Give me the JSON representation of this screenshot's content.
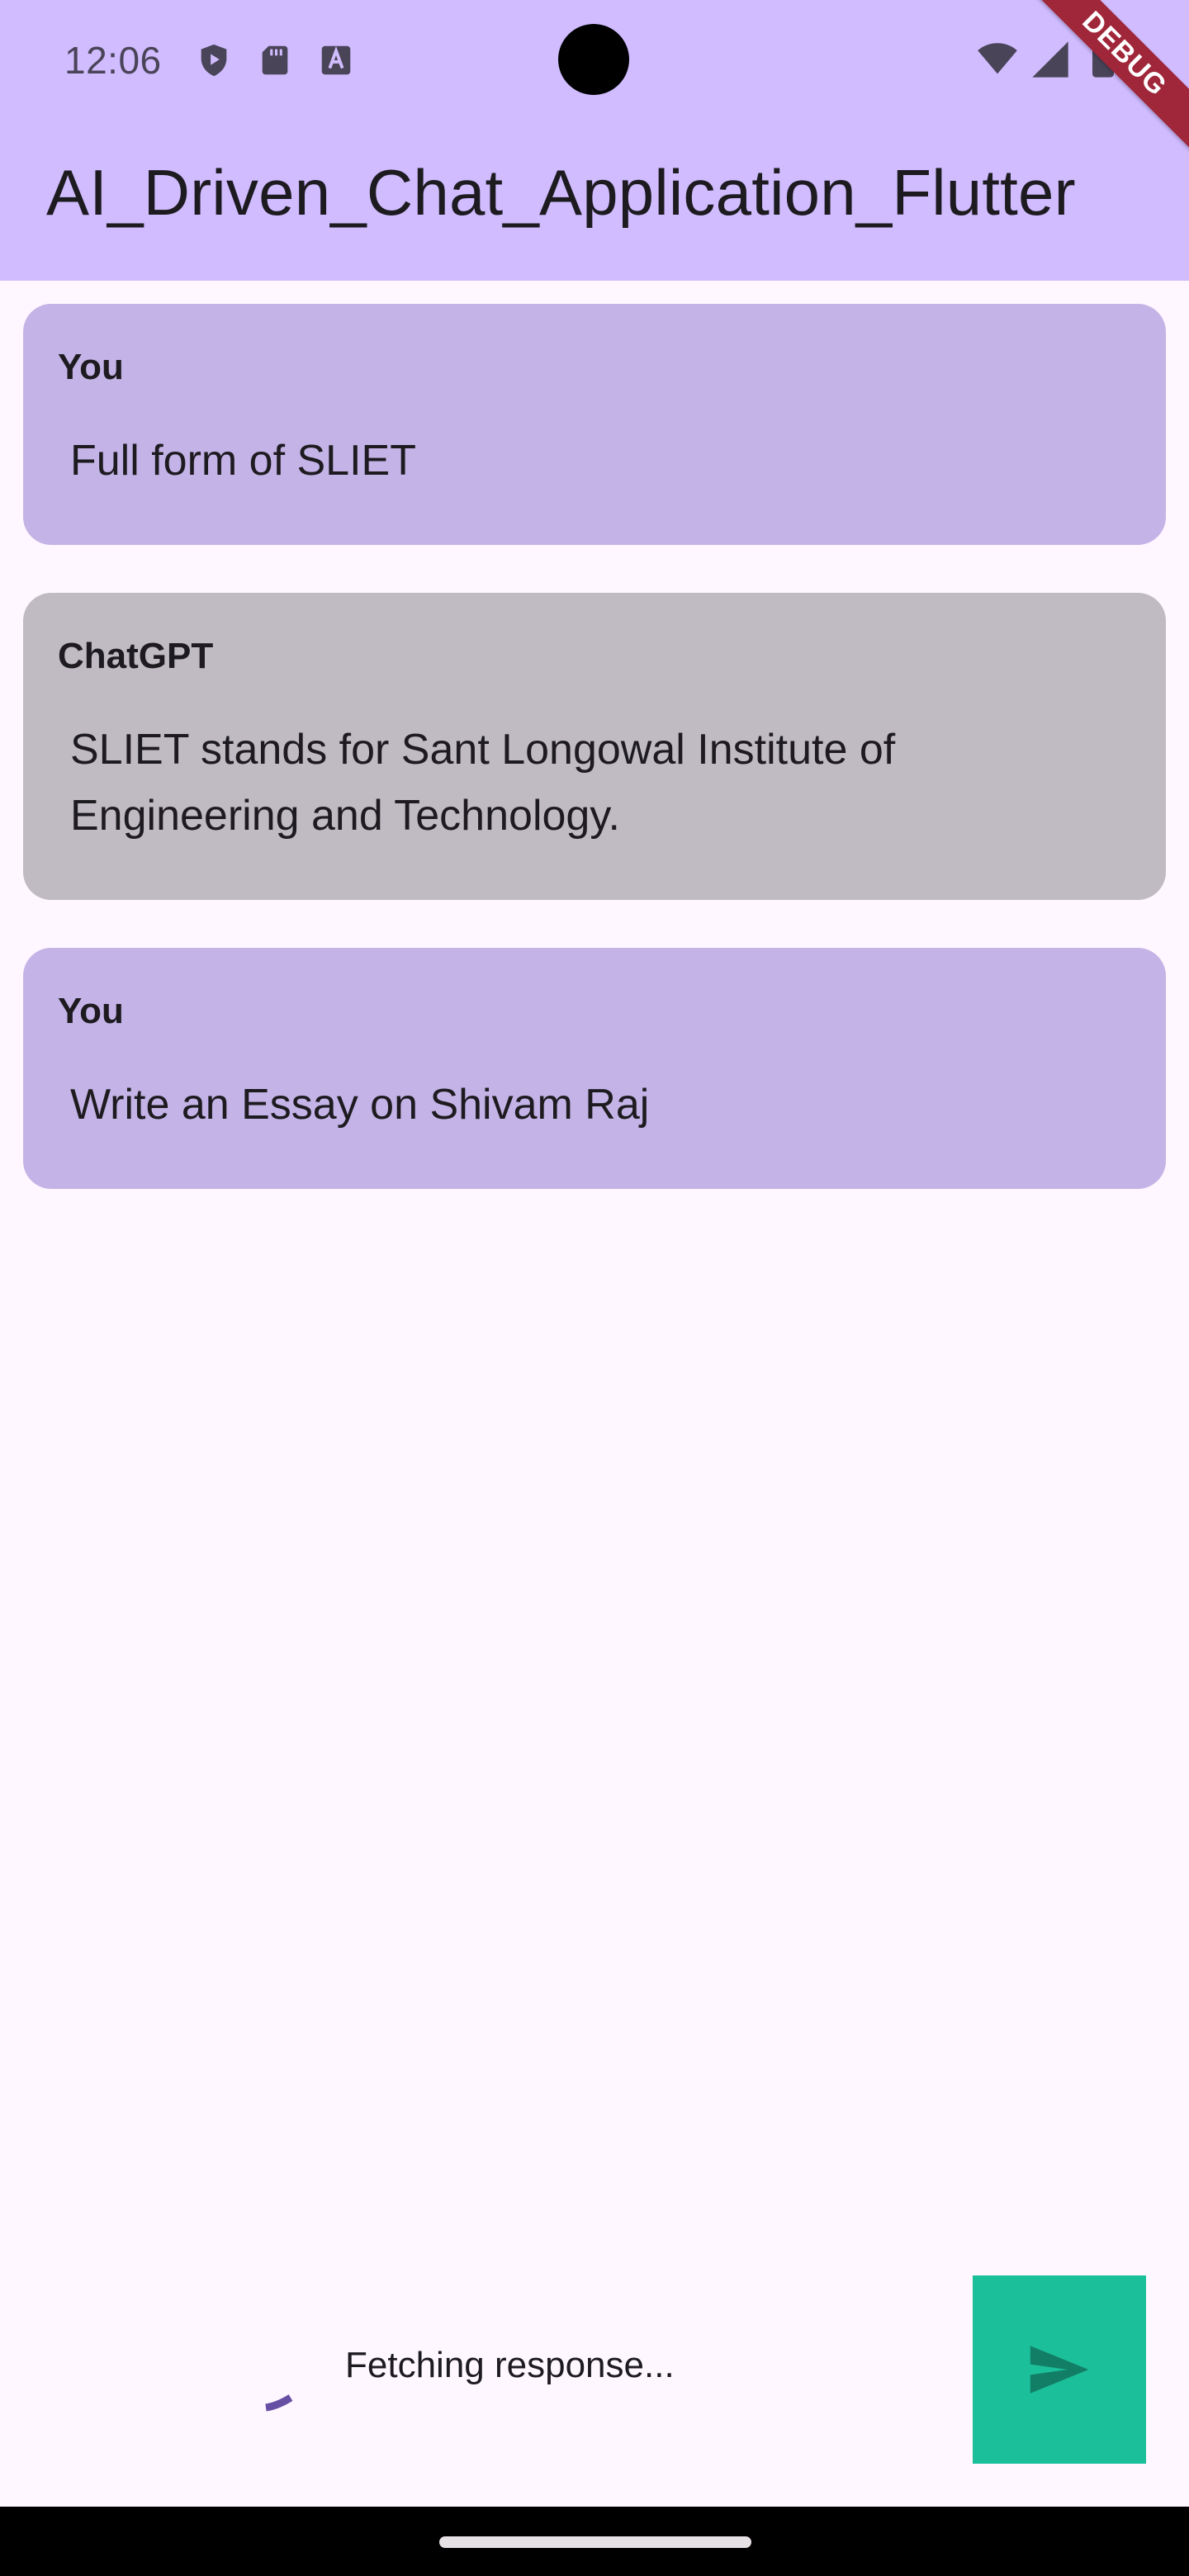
{
  "status_bar": {
    "time": "12:06",
    "left_icons": [
      "play-protect-icon",
      "sd-card-icon",
      "font-a-icon"
    ],
    "right_icons": [
      "wifi-icon",
      "cell-signal-icon",
      "battery-icon"
    ]
  },
  "debug_banner": {
    "label": "DEBUG"
  },
  "app_bar": {
    "title": "AI_Driven_Chat_Application_Flutter"
  },
  "messages": [
    {
      "sender": "You",
      "text": "Full form of SLIET",
      "role": "user"
    },
    {
      "sender": "ChatGPT",
      "text": "SLIET stands for Sant Longowal Institute of Engineering and Technology.",
      "role": "bot"
    },
    {
      "sender": "You",
      "text": "Write an Essay on Shivam Raj",
      "role": "user"
    }
  ],
  "input_area": {
    "status_text": "Fetching response...",
    "loading_icon": "progress-spinner-icon",
    "send_icon": "send-icon"
  },
  "colors": {
    "header": "#D0BCFF",
    "background": "#FEF7FF",
    "user_bubble": "#C4B3E6",
    "bot_bubble": "#C0BBC3",
    "send_button": "#1BBF9A",
    "spinner": "#6750A4",
    "debug_ribbon": "#A0263A"
  }
}
